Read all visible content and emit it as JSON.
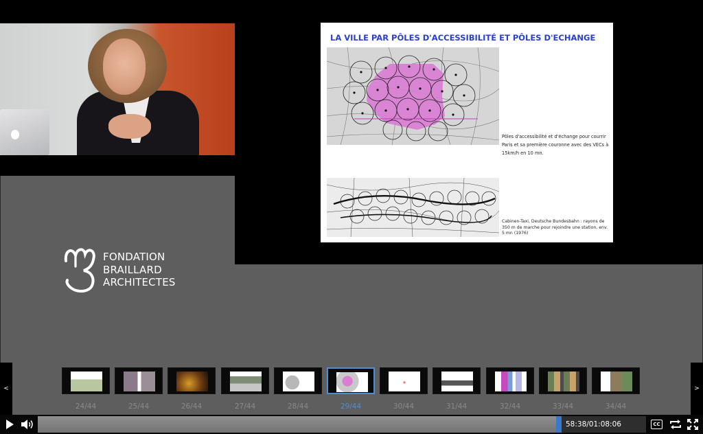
{
  "slide": {
    "title": "LA VILLE PAR PÔLES D'ACCESSIBILITÉ ET PÔLES D'ECHANGE",
    "caption1": "Pôles d'accessibilité et d'échange pour courrir Paris et sa première couronne avec des VECs à 15km/h en 10 mn.",
    "caption2": "Cabinen-Taxi, Deutsche Bundesbahn : rayons de 350 m de marche pour rejoindre une station, env. 5 mn (1976)"
  },
  "logo": {
    "line1": "FONDATION",
    "line2": "BRAILLARD",
    "line3": "ARCHITECTES"
  },
  "thumbnails": {
    "prev_label": "<",
    "next_label": ">",
    "items": [
      {
        "label": "24/44"
      },
      {
        "label": "25/44"
      },
      {
        "label": "26/44"
      },
      {
        "label": "27/44"
      },
      {
        "label": "28/44"
      },
      {
        "label": "29/44",
        "active": true
      },
      {
        "label": "30/44"
      },
      {
        "label": "31/44"
      },
      {
        "label": "32/44"
      },
      {
        "label": "33/44"
      },
      {
        "label": "34/44"
      }
    ]
  },
  "player": {
    "time": "58:38/01:08:06",
    "cc_label": "CC",
    "progress": 0.861,
    "accent": "#3a78c9"
  },
  "icons": {
    "play": "play-icon",
    "volume": "volume-icon",
    "loop": "loop-icon",
    "fullscreen": "fullscreen-icon"
  }
}
